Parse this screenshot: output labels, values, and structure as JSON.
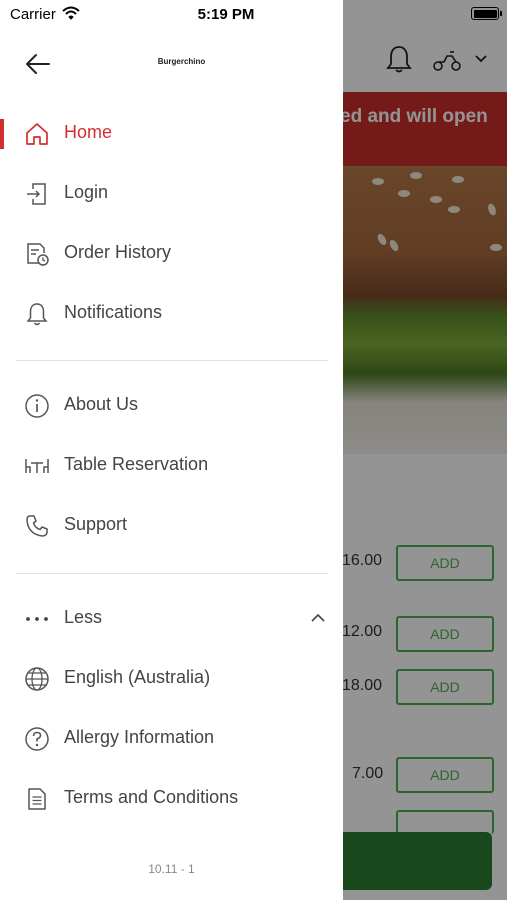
{
  "status_bar": {
    "carrier": "Carrier",
    "time": "5:19 PM"
  },
  "drawer": {
    "brand": "Burgerchino",
    "menu_primary": [
      {
        "label": "Home",
        "icon": "home-icon",
        "active": true
      },
      {
        "label": "Login",
        "icon": "login-icon"
      },
      {
        "label": "Order History",
        "icon": "order-history-icon"
      },
      {
        "label": "Notifications",
        "icon": "bell-icon"
      }
    ],
    "menu_secondary": [
      {
        "label": "About Us",
        "icon": "info-icon"
      },
      {
        "label": "Table Reservation",
        "icon": "table-icon"
      },
      {
        "label": "Support",
        "icon": "phone-icon"
      }
    ],
    "menu_more": {
      "toggle_label": "Less",
      "items": [
        {
          "label": "English (Australia)",
          "icon": "globe-icon"
        },
        {
          "label": "Allergy Information",
          "icon": "help-icon"
        },
        {
          "label": "Terms and Conditions",
          "icon": "document-icon"
        }
      ]
    },
    "version": "10.11 - 1"
  },
  "background": {
    "banner_text": "ed and will open",
    "items": [
      {
        "price": "16.00",
        "action": "ADD"
      },
      {
        "price": "12.00",
        "action": "ADD"
      },
      {
        "price": "18.00",
        "action": "ADD"
      },
      {
        "price": "7.00",
        "action": "ADD"
      }
    ]
  },
  "colors": {
    "accent": "#d32f2f",
    "banner": "#c9302c",
    "add_green": "#4caf50",
    "cta_green": "#2e7d32"
  }
}
